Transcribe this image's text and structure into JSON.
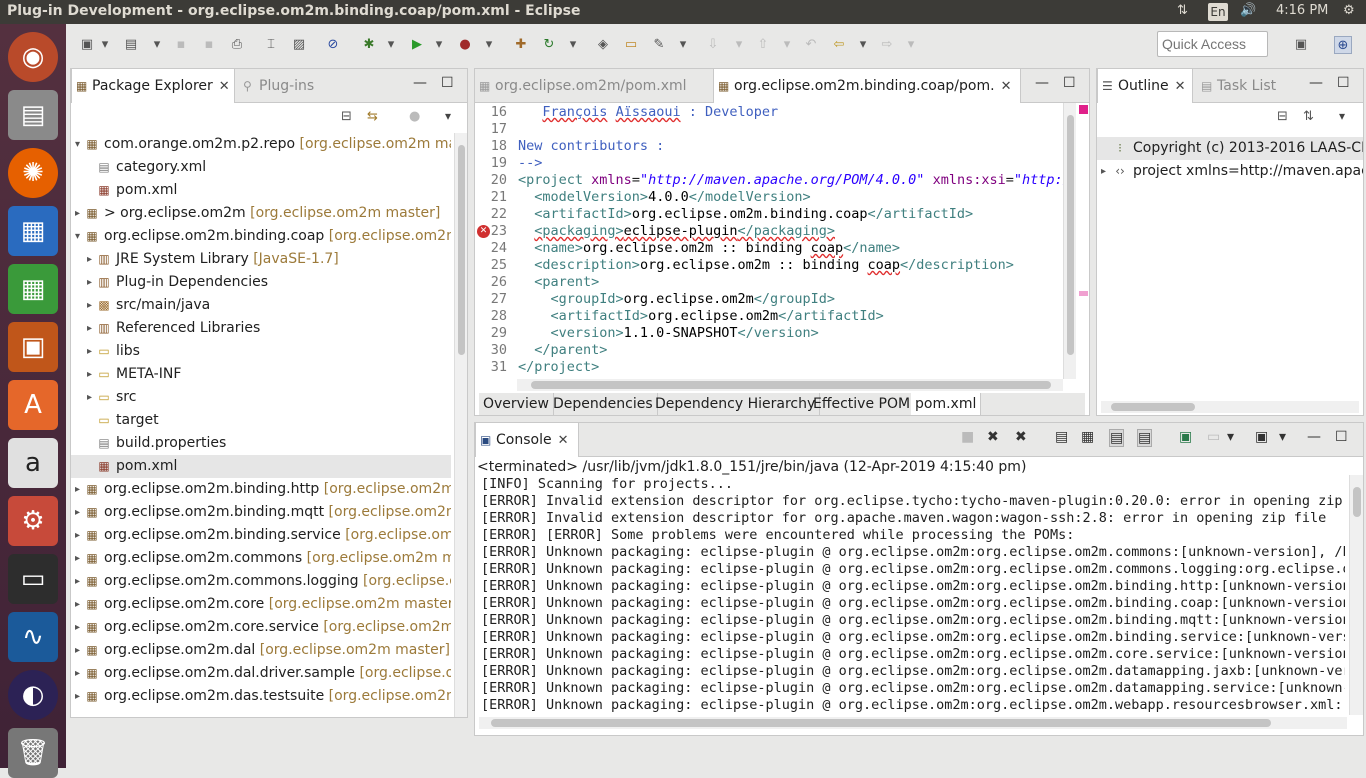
{
  "window": {
    "title": "Plug-in Development - org.eclipse.om2m.binding.coap/pom.xml - Eclipse",
    "lang": "En",
    "time": "4:16 PM"
  },
  "toolbar": {
    "quick_access_placeholder": "Quick Access"
  },
  "package_explorer": {
    "tab_label": "Package Explorer",
    "tab_inactive": "Plug-ins",
    "rows": [
      {
        "label": "com.orange.om2m.p2.repo",
        "dec": "[org.eclipse.om2m mas",
        "indent": 0,
        "twisty": "▾",
        "icon": "proj"
      },
      {
        "label": "category.xml",
        "dec": "",
        "indent": 1,
        "twisty": "",
        "icon": "file"
      },
      {
        "label": "pom.xml",
        "dec": "",
        "indent": 1,
        "twisty": "",
        "icon": "pom"
      },
      {
        "label": "> org.eclipse.om2m",
        "dec": "[org.eclipse.om2m master]",
        "indent": 0,
        "twisty": "▸",
        "icon": "proj"
      },
      {
        "label": "org.eclipse.om2m.binding.coap",
        "dec": "[org.eclipse.om2m",
        "indent": 0,
        "twisty": "▾",
        "icon": "proj"
      },
      {
        "label": "JRE System Library",
        "dec": "[JavaSE-1.7]",
        "indent": 1,
        "twisty": "▸",
        "icon": "lib"
      },
      {
        "label": "Plug-in Dependencies",
        "dec": "",
        "indent": 1,
        "twisty": "▸",
        "icon": "lib"
      },
      {
        "label": "src/main/java",
        "dec": "",
        "indent": 1,
        "twisty": "▸",
        "icon": "src"
      },
      {
        "label": "Referenced Libraries",
        "dec": "",
        "indent": 1,
        "twisty": "▸",
        "icon": "lib"
      },
      {
        "label": "libs",
        "dec": "",
        "indent": 1,
        "twisty": "▸",
        "icon": "folder"
      },
      {
        "label": "META-INF",
        "dec": "",
        "indent": 1,
        "twisty": "▸",
        "icon": "folder"
      },
      {
        "label": "src",
        "dec": "",
        "indent": 1,
        "twisty": "▸",
        "icon": "folder"
      },
      {
        "label": "target",
        "dec": "",
        "indent": 1,
        "twisty": "",
        "icon": "folder"
      },
      {
        "label": "build.properties",
        "dec": "",
        "indent": 1,
        "twisty": "",
        "icon": "file"
      },
      {
        "label": "pom.xml",
        "dec": "",
        "indent": 1,
        "twisty": "",
        "icon": "pom",
        "selected": true
      },
      {
        "label": "org.eclipse.om2m.binding.http",
        "dec": "[org.eclipse.om2m r",
        "indent": 0,
        "twisty": "▸",
        "icon": "proj"
      },
      {
        "label": "org.eclipse.om2m.binding.mqtt",
        "dec": "[org.eclipse.om2m",
        "indent": 0,
        "twisty": "▸",
        "icon": "proj"
      },
      {
        "label": "org.eclipse.om2m.binding.service",
        "dec": "[org.eclipse.om2r",
        "indent": 0,
        "twisty": "▸",
        "icon": "proj"
      },
      {
        "label": "org.eclipse.om2m.commons",
        "dec": "[org.eclipse.om2m ma",
        "indent": 0,
        "twisty": "▸",
        "icon": "proj"
      },
      {
        "label": "org.eclipse.om2m.commons.logging",
        "dec": "[org.eclipse.on",
        "indent": 0,
        "twisty": "▸",
        "icon": "proj"
      },
      {
        "label": "org.eclipse.om2m.core",
        "dec": "[org.eclipse.om2m master]",
        "indent": 0,
        "twisty": "▸",
        "icon": "proj"
      },
      {
        "label": "org.eclipse.om2m.core.service",
        "dec": "[org.eclipse.om2m n",
        "indent": 0,
        "twisty": "▸",
        "icon": "proj"
      },
      {
        "label": "org.eclipse.om2m.dal",
        "dec": "[org.eclipse.om2m master]",
        "indent": 0,
        "twisty": "▸",
        "icon": "proj"
      },
      {
        "label": "org.eclipse.om2m.dal.driver.sample",
        "dec": "[org.eclipse.om",
        "indent": 0,
        "twisty": "▸",
        "icon": "proj"
      },
      {
        "label": "org.eclipse.om2m.das.testsuite",
        "dec": "[org.eclipse.om2m",
        "indent": 0,
        "twisty": "▸",
        "icon": "proj"
      }
    ]
  },
  "editor": {
    "tab_inactive": "org.eclipse.om2m/pom.xml",
    "tab_active": "org.eclipse.om2m.binding.coap/pom.",
    "bottom_tabs": [
      "Overview",
      "Dependencies",
      "Dependency Hierarchy",
      "Effective POM",
      "pom.xml"
    ],
    "lines": [
      {
        "n": "16",
        "html": "   <span class='cmt'><span class='squig'>François</span> <span class='squig'>Aïssaoui</span> : Developer</span>"
      },
      {
        "n": "17",
        "html": ""
      },
      {
        "n": "18",
        "html": "<span class='cmt'>New contributors :</span>"
      },
      {
        "n": "19",
        "html": "<span class='cmt'>--&gt;</span>"
      },
      {
        "n": "20",
        "html": "<span class='tagc'>&lt;project</span> <span class='attrn'>xmlns</span>=<span class='attrv'>\"http://maven.apache.org/POM/4.0.0\"</span> <span class='attrn'>xmlns:xsi</span>=<span class='attrv'>\"http:/</span>"
      },
      {
        "n": "21",
        "html": "  <span class='tagc'>&lt;modelVersion&gt;</span><span class='txt'>4.0.0</span><span class='tagc'>&lt;/modelVersion&gt;</span>"
      },
      {
        "n": "22",
        "html": "  <span class='tagc'>&lt;artifactId&gt;</span><span class='txt'>org.eclipse.om2m.binding.coap</span><span class='tagc'>&lt;/artifactId&gt;</span>"
      },
      {
        "n": "23",
        "html": "  <span class='squig'><span class='tagc'>&lt;packaging&gt;</span><span class='txt'>eclipse-plugin</span><span class='tagc'>&lt;/packaging&gt;</span></span>",
        "error": true
      },
      {
        "n": "24",
        "html": "  <span class='tagc'>&lt;name&gt;</span><span class='txt'>org.eclipse.om2m :: binding <span class='squig'>coap</span></span><span class='tagc'>&lt;/name&gt;</span>"
      },
      {
        "n": "25",
        "html": "  <span class='tagc'>&lt;description&gt;</span><span class='txt'>org.eclipse.om2m :: binding <span class='squig'>coap</span></span><span class='tagc'>&lt;/description&gt;</span>"
      },
      {
        "n": "26",
        "html": "  <span class='tagc'>&lt;parent&gt;</span>"
      },
      {
        "n": "27",
        "html": "    <span class='tagc'>&lt;groupId&gt;</span><span class='txt'>org.eclipse.om2m</span><span class='tagc'>&lt;/groupId&gt;</span>"
      },
      {
        "n": "28",
        "html": "    <span class='tagc'>&lt;artifactId&gt;</span><span class='txt'>org.eclipse.om2m</span><span class='tagc'>&lt;/artifactId&gt;</span>"
      },
      {
        "n": "29",
        "html": "    <span class='tagc'>&lt;version&gt;</span><span class='txt'>1.1.0-SNAPSHOT</span><span class='tagc'>&lt;/version&gt;</span>"
      },
      {
        "n": "30",
        "html": "  <span class='tagc'>&lt;/parent&gt;</span>"
      },
      {
        "n": "31",
        "html": "<span class='tagc'>&lt;/project&gt;</span>"
      }
    ]
  },
  "outline": {
    "tab_label": "Outline",
    "tab_inactive": "Task List",
    "items": [
      {
        "label": "Copyright (c) 2013-2016 LAAS-CNRS",
        "twisty": "",
        "selected": true
      },
      {
        "label": "project xmlns=http://maven.apache",
        "twisty": "▸"
      }
    ]
  },
  "console": {
    "tab_label": "Console",
    "status": "<terminated> /usr/lib/jvm/jdk1.8.0_151/jre/bin/java (12-Apr-2019 4:15:40 pm)",
    "lines": [
      "[INFO] Scanning for projects...",
      "[ERROR] Invalid extension descriptor for org.eclipse.tycho:tycho-maven-plugin:0.20.0: error in opening zip f",
      "[ERROR] Invalid extension descriptor for org.apache.maven.wagon:wagon-ssh:2.8: error in opening zip file",
      "[ERROR] [ERROR] Some problems were encountered while processing the POMs:",
      "[ERROR] Unknown packaging: eclipse-plugin @ org.eclipse.om2m:org.eclipse.om2m.commons:[unknown-version], /ho",
      "[ERROR] Unknown packaging: eclipse-plugin @ org.eclipse.om2m:org.eclipse.om2m.commons.logging:org.eclipse.om2m.commons.loggin",
      "[ERROR] Unknown packaging: eclipse-plugin @ org.eclipse.om2m:org.eclipse.om2m.binding.http:[unknown-version]",
      "[ERROR] Unknown packaging: eclipse-plugin @ org.eclipse.om2m:org.eclipse.om2m.binding.coap:[unknown-version]",
      "[ERROR] Unknown packaging: eclipse-plugin @ org.eclipse.om2m:org.eclipse.om2m.binding.mqtt:[unknown-version]",
      "[ERROR] Unknown packaging: eclipse-plugin @ org.eclipse.om2m:org.eclipse.om2m.binding.service:[unknown-versi",
      "[ERROR] Unknown packaging: eclipse-plugin @ org.eclipse.om2m:org.eclipse.om2m.core.service:[unknown-version]",
      "[ERROR] Unknown packaging: eclipse-plugin @ org.eclipse.om2m:org.eclipse.om2m.datamapping.jaxb:[unknown-vers",
      "[ERROR] Unknown packaging: eclipse-plugin @ org.eclipse.om2m:org.eclipse.om2m.datamapping.service:[unknown-v",
      "[ERROR] Unknown packaging: eclipse-plugin @ org.eclipse.om2m:org.eclipse.om2m.webapp.resourcesbrowser.xml:[u"
    ]
  }
}
